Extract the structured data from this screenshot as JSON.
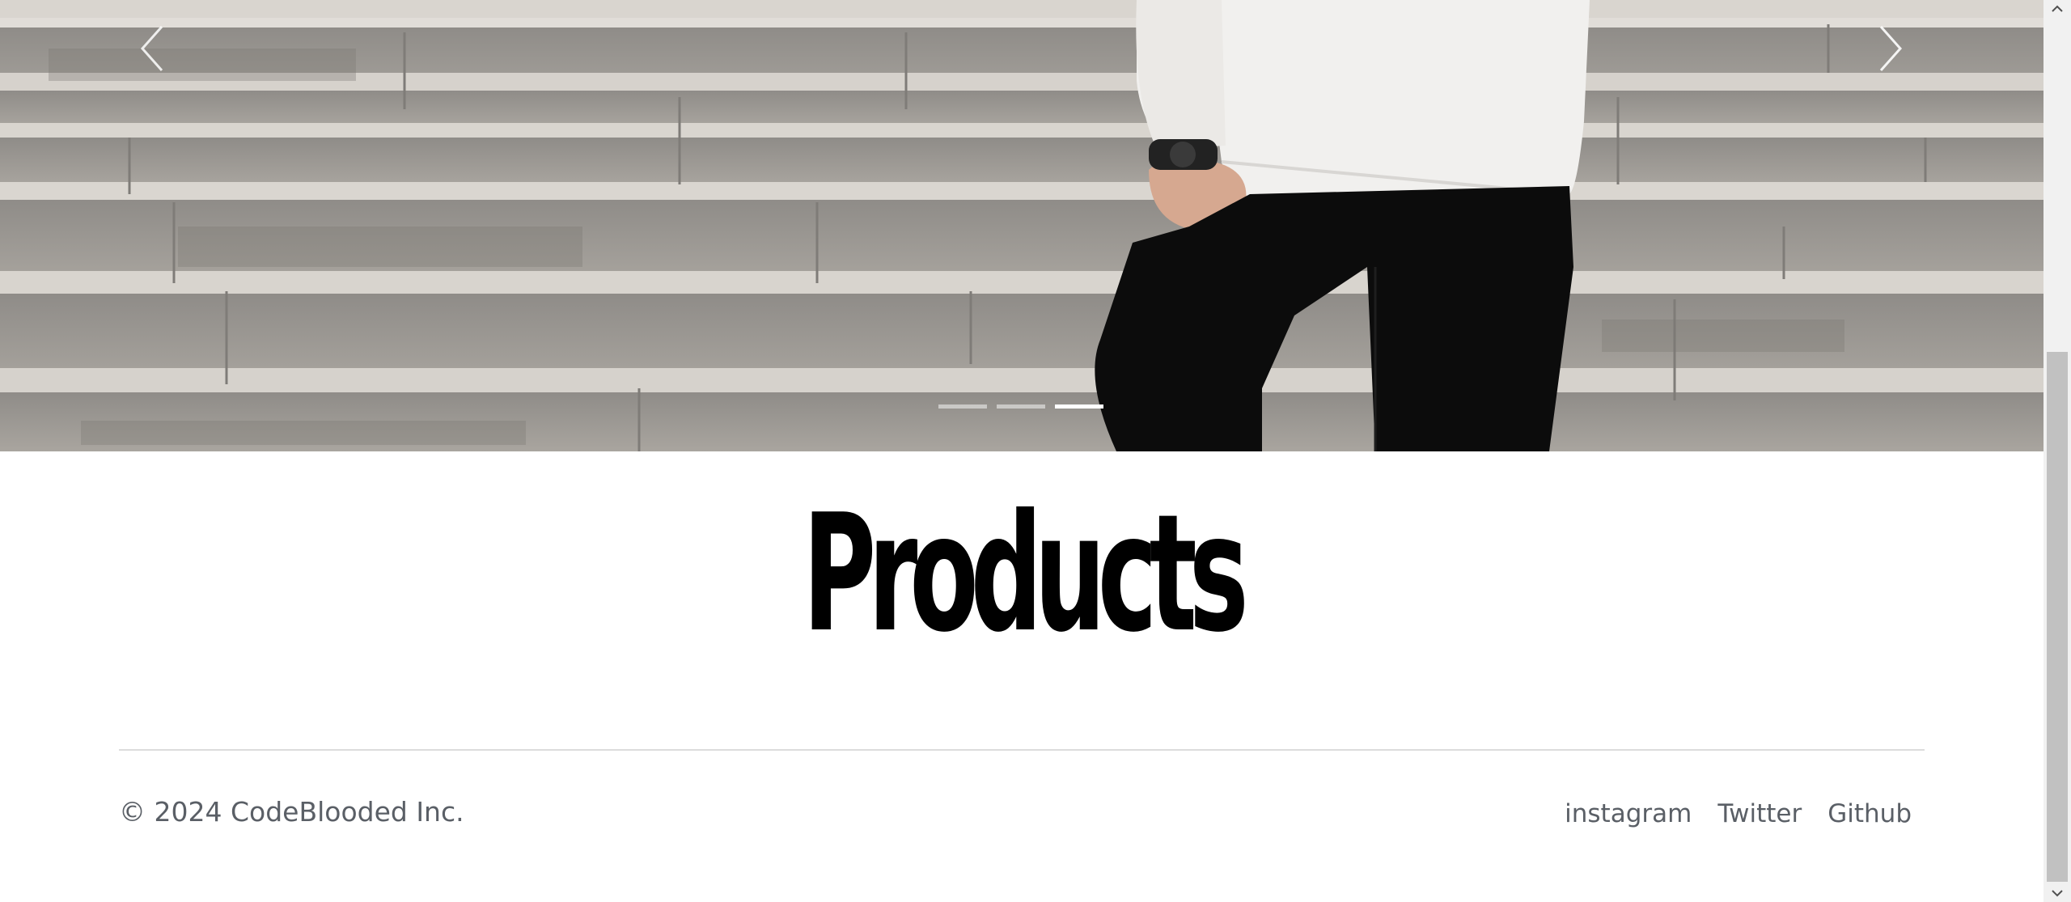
{
  "carousel": {
    "slides_total": 3,
    "active_index": 2,
    "prev_icon": "chevron-left-icon",
    "next_icon": "chevron-right-icon",
    "image_subject": "person in white sweatshirt and black jeans on stone steps"
  },
  "main": {
    "heading": "Products"
  },
  "footer": {
    "copyright": "© 2024 CodeBlooded Inc.",
    "links": [
      {
        "label": "instagram"
      },
      {
        "label": "Twitter"
      },
      {
        "label": "Github"
      }
    ]
  },
  "scrollbar": {
    "up_icon": "chevron-up-icon",
    "down_icon": "chevron-down-icon"
  },
  "colors": {
    "text_primary": "#000000",
    "text_muted": "#5a5f66",
    "divider": "#dcdcdc",
    "indicator_active": "#ffffff"
  }
}
